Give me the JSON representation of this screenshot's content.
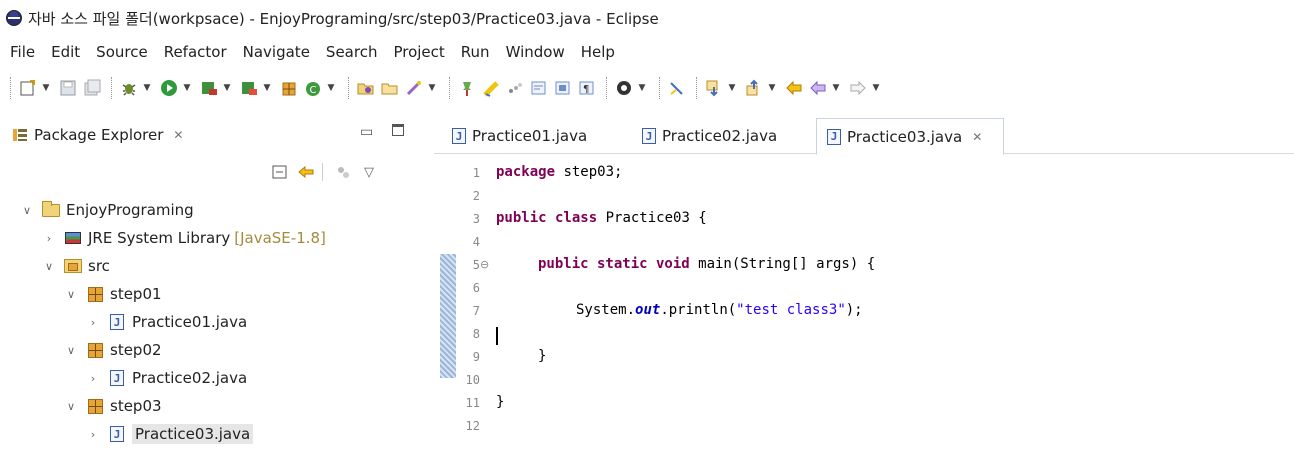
{
  "window": {
    "title": "자바 소스 파일 폴더(workpsace) - EnjoyPrograming/src/step03/Practice03.java - Eclipse"
  },
  "menu": [
    "File",
    "Edit",
    "Source",
    "Refactor",
    "Navigate",
    "Search",
    "Project",
    "Run",
    "Window",
    "Help"
  ],
  "package_explorer": {
    "title": "Package Explorer",
    "tree": [
      {
        "label": "EnjoyPrograming",
        "icon": "project-folder-icon",
        "expanded": true
      },
      {
        "label": "JRE System Library",
        "decoration": "[JavaSE-1.8]",
        "icon": "library-icon",
        "expanded": false
      },
      {
        "label": "src",
        "icon": "source-folder-icon",
        "expanded": true
      },
      {
        "label": "step01",
        "icon": "package-icon",
        "expanded": true
      },
      {
        "label": "Practice01.java",
        "icon": "java-file-icon",
        "expanded": false
      },
      {
        "label": "step02",
        "icon": "package-icon",
        "expanded": true
      },
      {
        "label": "Practice02.java",
        "icon": "java-file-icon",
        "expanded": false
      },
      {
        "label": "step03",
        "icon": "package-icon",
        "expanded": true
      },
      {
        "label": "Practice03.java",
        "icon": "java-file-icon",
        "expanded": false,
        "selected": true
      }
    ]
  },
  "editor": {
    "tabs": [
      {
        "label": "Practice01.java",
        "active": false
      },
      {
        "label": "Practice02.java",
        "active": false
      },
      {
        "label": "Practice03.java",
        "active": true
      }
    ],
    "line_numbers": [
      "1",
      "2",
      "3",
      "4",
      "5",
      "6",
      "7",
      "8",
      "9",
      "10",
      "11",
      "12"
    ],
    "code": {
      "l1_kw": "package",
      "l1_rest": " step03;",
      "l3_kw": "public class",
      "l3_rest": " Practice03 {",
      "l5_kw": "public static void",
      "l5_rest": " main(String[] args) {",
      "l7_pre": "System.",
      "l7_field": "out",
      "l7_mid": ".println(",
      "l7_str": "\"test class3\"",
      "l7_end": ");",
      "l9": "}",
      "l11": "}"
    }
  }
}
